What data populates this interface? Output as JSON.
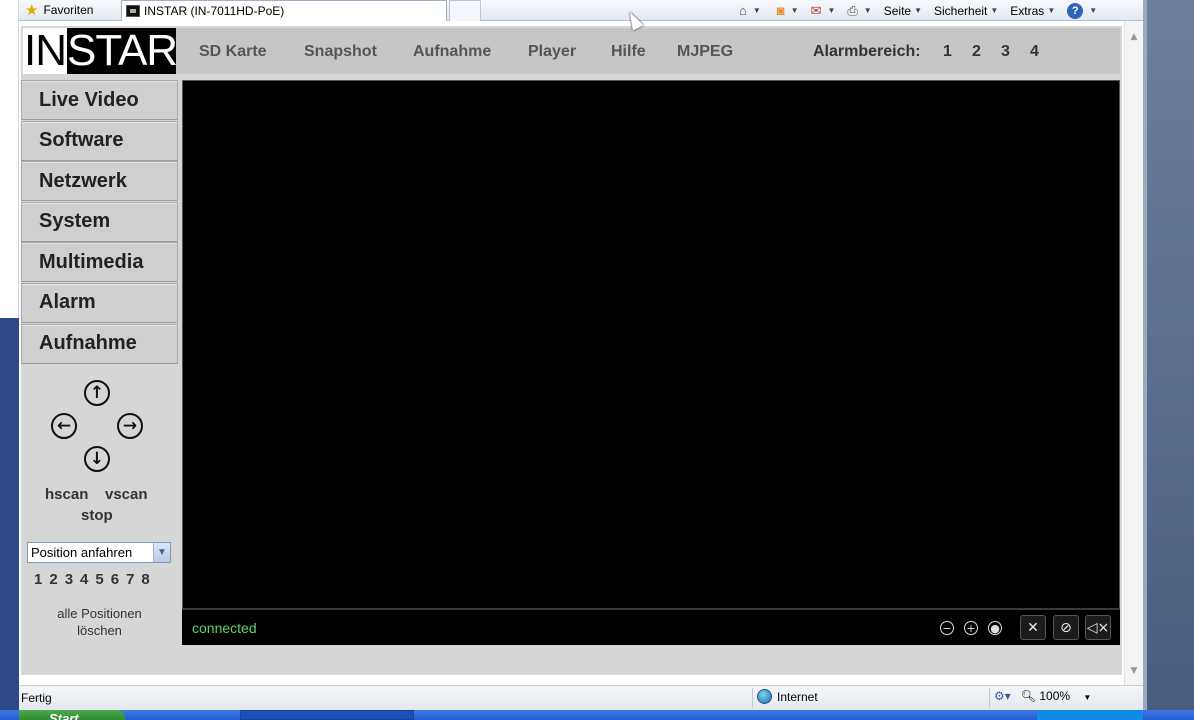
{
  "browser": {
    "favorites_label": "Favoriten",
    "tab_title": "INSTAR (IN-7011HD-PoE)",
    "menus": [
      "Seite",
      "Sicherheit",
      "Extras"
    ],
    "status_text": "Fertig",
    "zone": "Internet",
    "zoom": "100%"
  },
  "camera": {
    "logo": {
      "part1": "IN",
      "part2": "STAR"
    },
    "topnav": [
      "SD Karte",
      "Snapshot",
      "Aufnahme",
      "Player",
      "Hilfe",
      "MJPEG"
    ],
    "alarm_label": "Alarmbereich:",
    "alarm_areas": [
      "1",
      "2",
      "3",
      "4"
    ],
    "sidebar": [
      "Live Video",
      "Software",
      "Netzwerk",
      "System",
      "Multimedia",
      "Alarm",
      "Aufnahme"
    ],
    "ptz": {
      "hscan": "hscan",
      "vscan": "vscan",
      "stop": "stop",
      "position_select": "Position anfahren",
      "positions": [
        "1",
        "2",
        "3",
        "4",
        "5",
        "6",
        "7",
        "8"
      ],
      "clear_line1": "alle Positionen",
      "clear_line2": "löschen"
    },
    "video_status": "connected"
  },
  "taskbar": {
    "start": "Start"
  },
  "colors": {
    "status_green": "#5fd26a",
    "panel_gray": "#d6d6d6"
  }
}
